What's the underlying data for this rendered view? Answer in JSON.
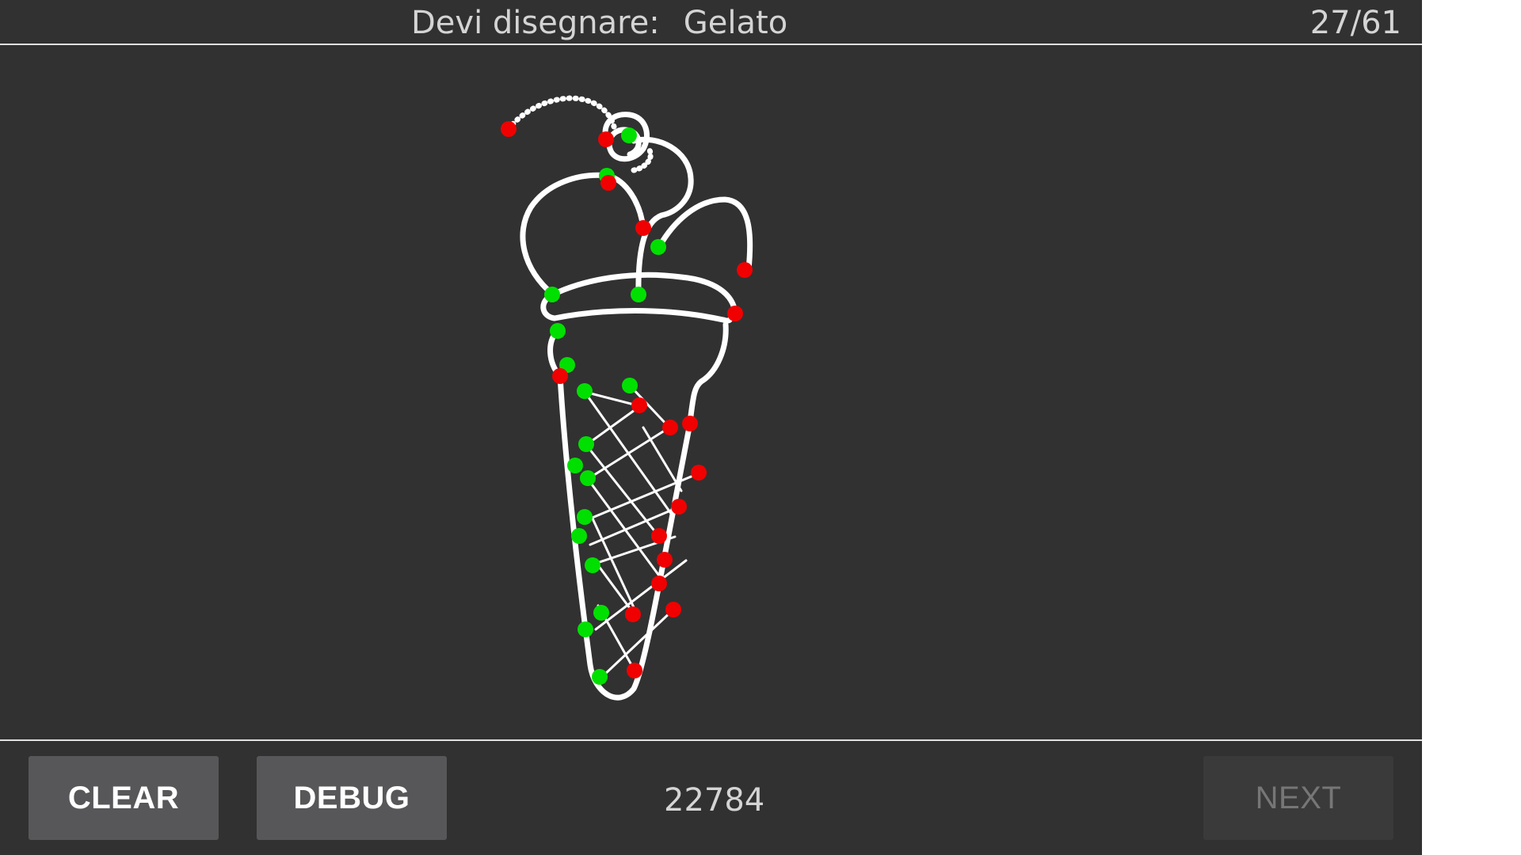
{
  "header": {
    "prompt_label": "Devi disegnare:",
    "target_word": "Gelato",
    "progress": "27/61"
  },
  "footer": {
    "clear_label": "CLEAR",
    "debug_label": "DEBUG",
    "score": "22784",
    "next_label": "NEXT"
  },
  "colors": {
    "background": "#313131",
    "stroke": "#ffffff",
    "stroke_start": "#00e000",
    "stroke_end": "#f00000"
  }
}
